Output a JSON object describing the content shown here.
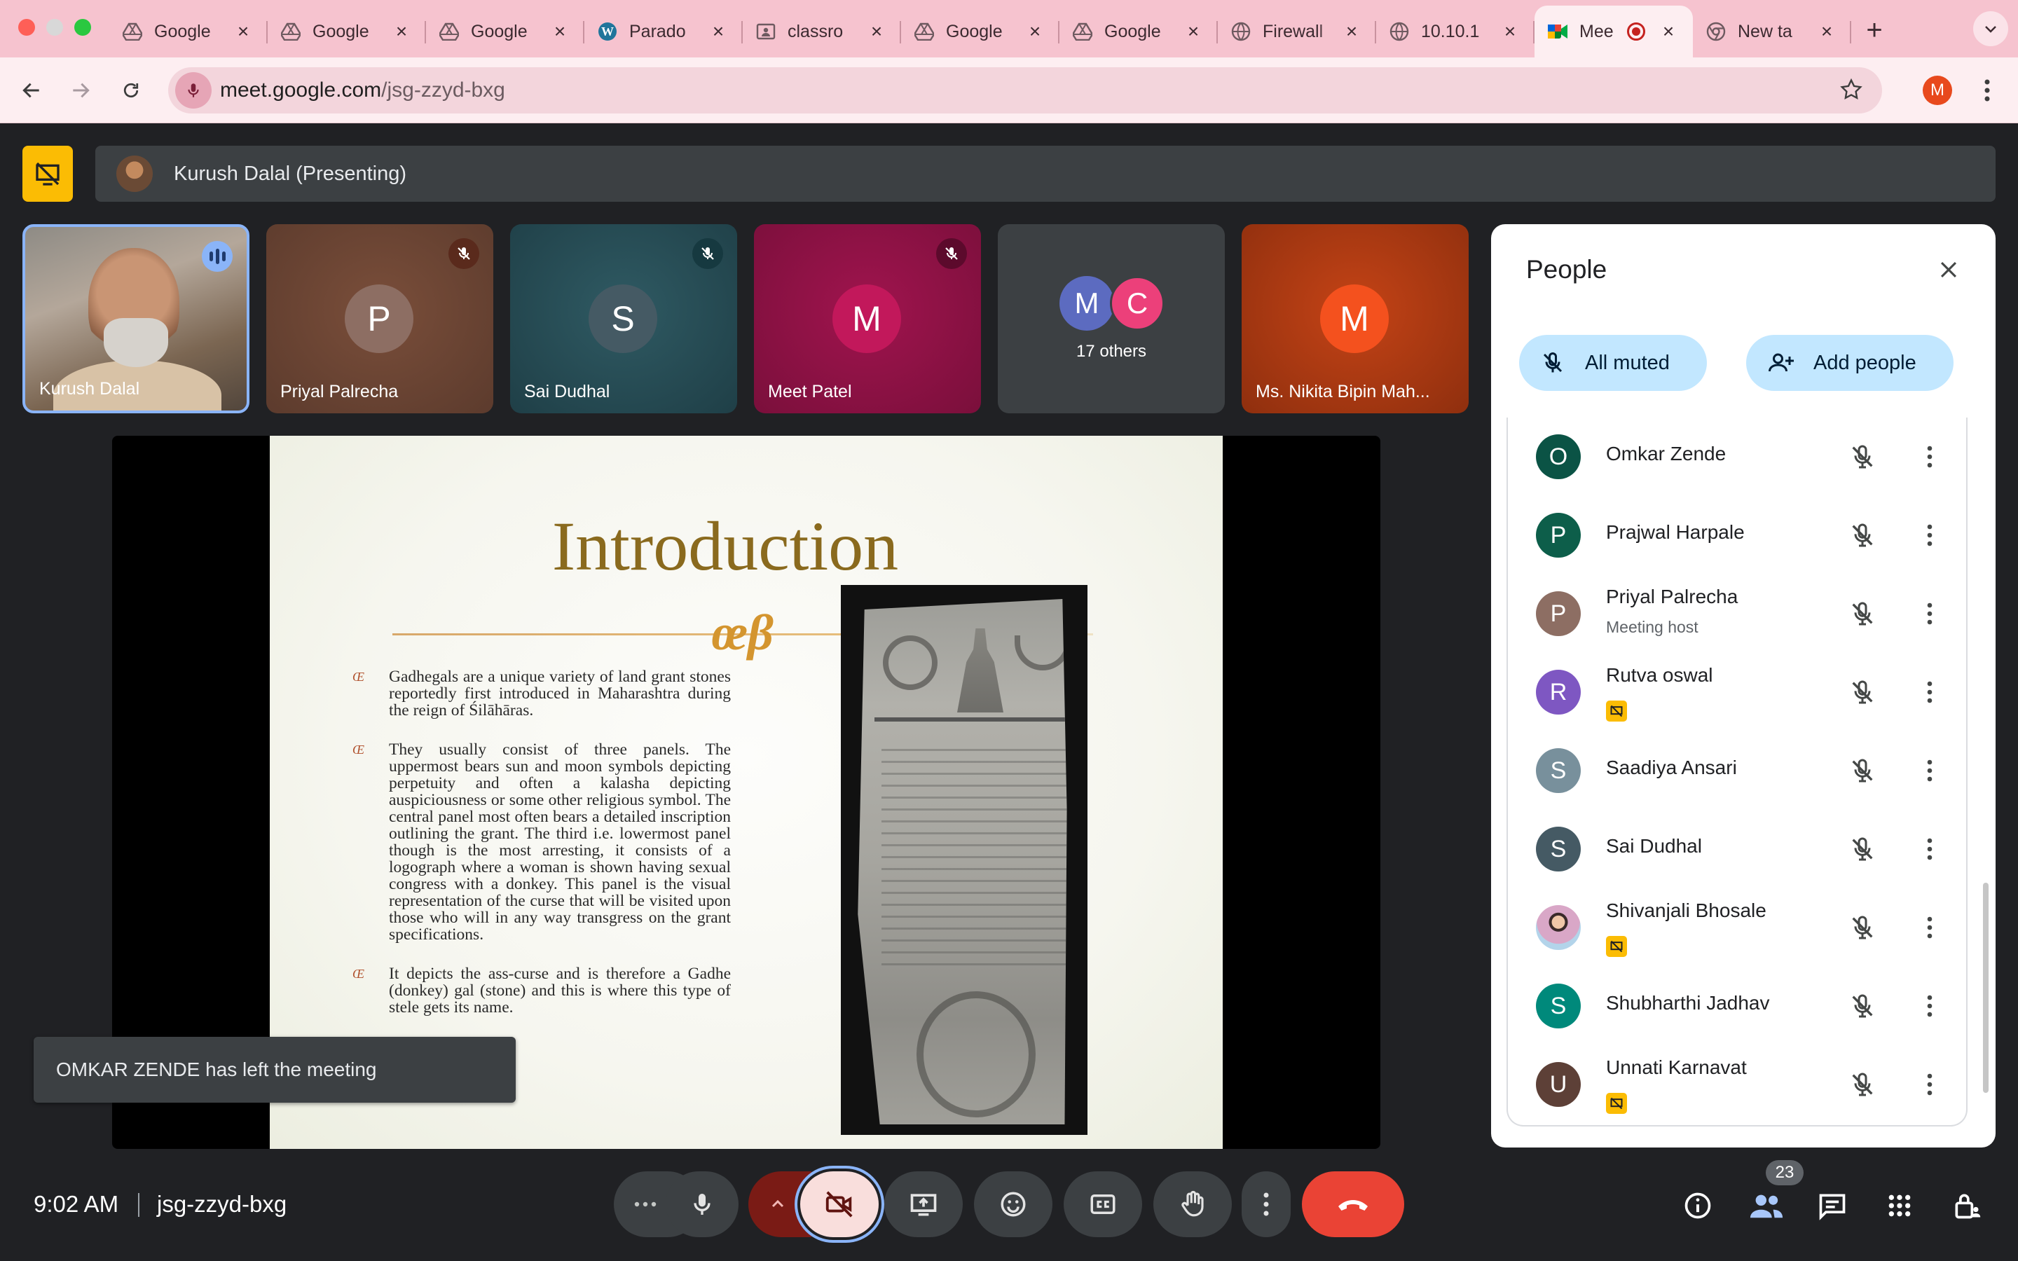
{
  "browser": {
    "tabs": [
      {
        "title": "Google",
        "icon": "drive-icon"
      },
      {
        "title": "Google",
        "icon": "drive-icon"
      },
      {
        "title": "Google",
        "icon": "drive-icon"
      },
      {
        "title": "Parado",
        "icon": "wordpress-icon"
      },
      {
        "title": "classro",
        "icon": "classroom-icon"
      },
      {
        "title": "Google",
        "icon": "drive-icon"
      },
      {
        "title": "Google",
        "icon": "drive-icon"
      },
      {
        "title": "Firewall",
        "icon": "globe-icon"
      },
      {
        "title": "10.10.1",
        "icon": "globe-icon"
      },
      {
        "title": "Mee",
        "icon": "meet-icon",
        "active": true,
        "recording": true
      },
      {
        "title": "New ta",
        "icon": "chrome-icon"
      }
    ],
    "address": {
      "host": "meet.google.com",
      "path": "/jsg-zzyd-bxg"
    },
    "profile_initial": "M"
  },
  "meet": {
    "presenter_label": "Kurush Dalal (Presenting)",
    "tiles": [
      {
        "name": "Kurush Dalal"
      },
      {
        "name": "Priyal Palrecha",
        "initial": "P"
      },
      {
        "name": "Sai Dudhal",
        "initial": "S"
      },
      {
        "name": "Meet Patel",
        "initial": "M"
      },
      {
        "others_label": "17 others",
        "initials": [
          "M",
          "C"
        ]
      },
      {
        "name": "Ms. Nikita Bipin Mah...",
        "initial": "M"
      }
    ],
    "slide": {
      "title": "Introduction",
      "bullets": [
        "Gadhegals are a unique variety of land grant stones reportedly first introduced in Maharashtra during the reign of Śilāhāras.",
        "They usually consist of three panels. The uppermost bears sun and moon symbols depicting perpetuity and often a kalasha depicting auspiciousness or some other religious symbol. The central panel most often bears a detailed inscription outlining the grant. The third i.e. lowermost panel though is the most arresting, it consists of a logograph where a woman is shown having sexual congress with a donkey. This panel is the visual representation of the curse that will be visited upon those who will in any way transgress on the grant specifications.",
        "It depicts the ass-curse and is therefore a Gadhe (donkey) gal (stone) and this is where this type of stele gets its name."
      ]
    },
    "toast": "OMKAR ZENDE has left the meeting",
    "clock": "9:02 AM",
    "meeting_code": "jsg-zzyd-bxg",
    "participant_count": "23"
  },
  "people_panel": {
    "title": "People",
    "all_muted_label": "All muted",
    "add_people_label": "Add people",
    "people": [
      {
        "name": "Omkar Zende",
        "initial": "O",
        "color": "#0b5345"
      },
      {
        "name": "Prajwal Harpale",
        "initial": "P",
        "color": "#0d5e4a"
      },
      {
        "name": "Priyal Palrecha",
        "initial": "P",
        "color": "#8d6e63",
        "subtitle": "Meeting host"
      },
      {
        "name": "Rutva oswal",
        "initial": "R",
        "color": "#7e57c2",
        "camera_off": true
      },
      {
        "name": "Saadiya Ansari",
        "initial": "S",
        "color": "#78909c"
      },
      {
        "name": "Sai Dudhal",
        "initial": "S",
        "color": "#455a64"
      },
      {
        "name": "Shivanjali Bhosale",
        "initial": "",
        "color": "#b3d4ea",
        "camera_off": true
      },
      {
        "name": "Shubharthi Jadhav",
        "initial": "S",
        "color": "#00897b"
      },
      {
        "name": "Unnati Karnavat",
        "initial": "U",
        "color": "#5d4037",
        "camera_off": true
      }
    ]
  },
  "colors": {
    "tab_bar": "#f6c3cf",
    "toolbar": "#fdeef1",
    "meet_bg": "#202124",
    "accent_blue": "#8ab4f8",
    "leave_red": "#ea4335",
    "presenting_yellow": "#fbbc04"
  }
}
